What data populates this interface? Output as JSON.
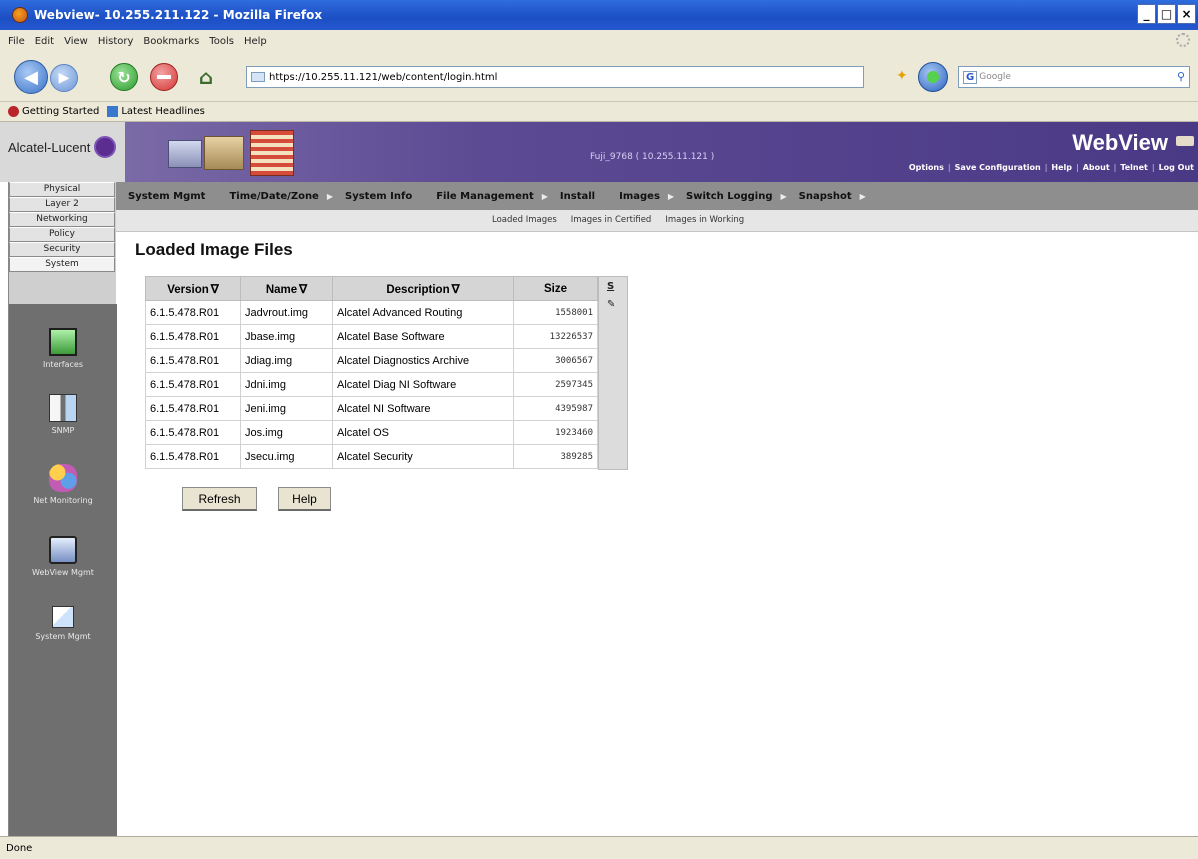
{
  "browser": {
    "window_title": "Webview- 10.255.211.122 - Mozilla Firefox",
    "menu": [
      "File",
      "Edit",
      "View",
      "History",
      "Bookmarks",
      "Tools",
      "Help"
    ],
    "url": "https://10.255.11.121/web/content/login.html",
    "search_placeholder": "Google",
    "bookmarks": [
      "Getting Started",
      "Latest Headlines"
    ],
    "status": "Done"
  },
  "header": {
    "brand": "Alcatel-Lucent",
    "switch_name": "Fuji_9768 ( 10.255.11.121 )",
    "title": "WebView",
    "links": [
      "Options",
      "Save Configuration",
      "Help",
      "About",
      "Telnet",
      "Log Out"
    ]
  },
  "sidebar": {
    "tabs": [
      "Physical",
      "Layer 2",
      "Networking",
      "Policy",
      "Security",
      "System"
    ],
    "active_tab": "System",
    "items": [
      {
        "label": "Interfaces",
        "icon": "interfaces-icon"
      },
      {
        "label": "SNMP",
        "icon": "snmp-icon"
      },
      {
        "label": "Net Monitoring",
        "icon": "net-monitoring-icon"
      },
      {
        "label": "WebView Mgmt",
        "icon": "webview-mgmt-icon"
      },
      {
        "label": "System Mgmt",
        "icon": "system-mgmt-icon"
      }
    ]
  },
  "nav": {
    "items": [
      "System Mgmt",
      "Time/Date/Zone",
      "System Info",
      "File Management",
      "Install",
      "Images",
      "Switch Logging",
      "Snapshot"
    ],
    "sub_items": [
      "Loaded Images",
      "Images in Certified",
      "Images in Working"
    ]
  },
  "main": {
    "title": "Loaded Image Files",
    "table": {
      "headers": [
        "Version",
        "Name",
        "Description",
        "Size"
      ],
      "rows": [
        [
          "6.1.5.478.R01",
          "Jadvrout.img",
          "Alcatel Advanced Routing",
          "1558001"
        ],
        [
          "6.1.5.478.R01",
          "Jbase.img",
          "Alcatel Base Software",
          "13226537"
        ],
        [
          "6.1.5.478.R01",
          "Jdiag.img",
          "Alcatel Diagnostics Archive",
          "3006567"
        ],
        [
          "6.1.5.478.R01",
          "Jdni.img",
          "Alcatel Diag NI Software",
          "2597345"
        ],
        [
          "6.1.5.478.R01",
          "Jeni.img",
          "Alcatel NI Software",
          "4395987"
        ],
        [
          "6.1.5.478.R01",
          "Jos.img",
          "Alcatel OS",
          "1923460"
        ],
        [
          "6.1.5.478.R01",
          "Jsecu.img",
          "Alcatel Security",
          "389285"
        ]
      ]
    },
    "side_button": "S",
    "buttons": {
      "refresh": "Refresh",
      "help": "Help"
    }
  }
}
